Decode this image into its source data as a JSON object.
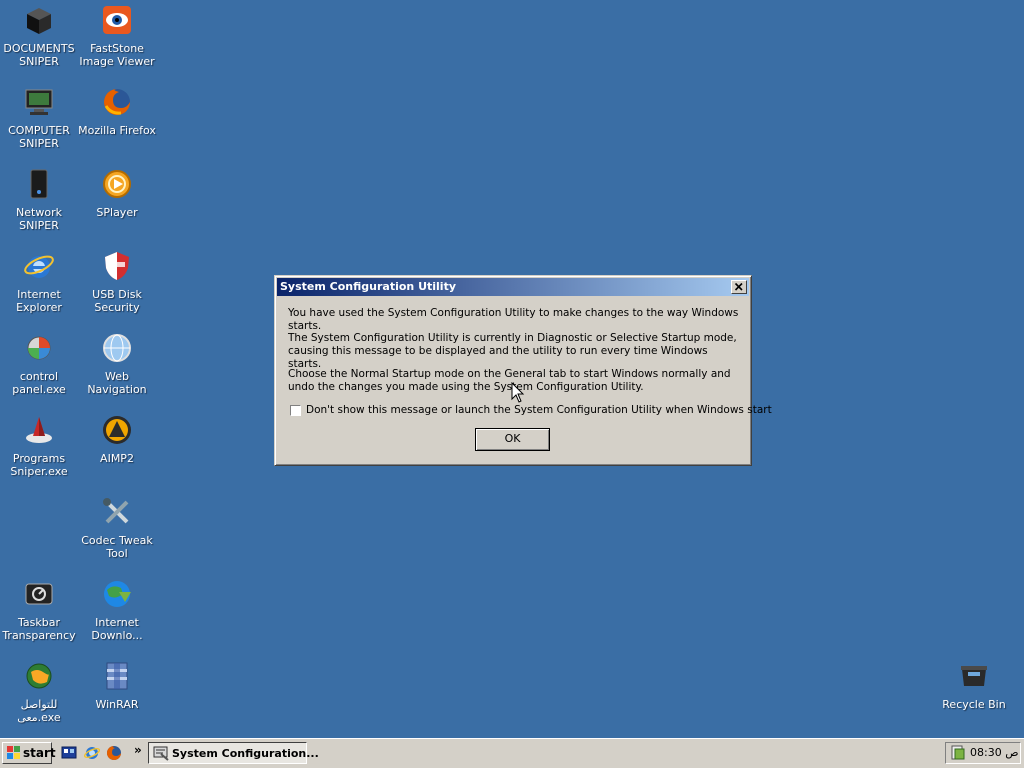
{
  "desktop": {
    "background_color": "#3a6ea5",
    "icons": [
      {
        "label": "DOCUMENTS\nSNIPER",
        "icon": "dark-box-icon"
      },
      {
        "label": "FastStone\nImage Viewer",
        "icon": "eye-icon"
      },
      {
        "label": "COMPUTER\nSNIPER",
        "icon": "computer-icon"
      },
      {
        "label": "Mozilla Firefox",
        "icon": "firefox-icon"
      },
      {
        "label": "Network\nSNIPER",
        "icon": "network-drive-icon"
      },
      {
        "label": "SPlayer",
        "icon": "splayer-icon"
      },
      {
        "label": "Internet\nExplorer",
        "icon": "internet-explorer-icon"
      },
      {
        "label": "USB Disk\nSecurity",
        "icon": "shield-icon"
      },
      {
        "label": "control\npanel.exe",
        "icon": "control-panel-icon"
      },
      {
        "label": "Web\nNavigation",
        "icon": "globe-icon"
      },
      {
        "label": "Programs\nSniper.exe",
        "icon": "programs-icon"
      },
      {
        "label": "AIMP2",
        "icon": "aimp-icon"
      },
      {
        "label": "Codec Tweak\nTool",
        "icon": "tools-icon"
      },
      {
        "label": "Taskbar\nTransparency",
        "icon": "taskbar-icon"
      },
      {
        "label": "Internet\nDownlo...",
        "icon": "download-globe-icon"
      },
      {
        "label": "للتواصل\nمعى.exe",
        "icon": "globe-people-icon"
      },
      {
        "label": "WinRAR",
        "icon": "winrar-icon"
      },
      {
        "label": "Recycle Bin",
        "icon": "recycle-bin-icon"
      }
    ]
  },
  "dialog": {
    "title": "System Configuration Utility",
    "message_1": "You have used the System Configuration Utility to make changes to the way Windows starts.",
    "message_2": "The System Configuration Utility is currently in Diagnostic or Selective Startup mode, causing this message to be displayed and the utility to run every time Windows starts.",
    "message_3": "Choose the Normal Startup mode on the General tab to start Windows normally and undo the changes you made using the System Configuration Utility.",
    "checkbox_label": "Don't show this message or launch the System Configuration Utility when Windows start",
    "checkbox_checked": false,
    "ok_label": "OK",
    "titlebar_color": "#0a246a"
  },
  "taskbar": {
    "start_label": "start",
    "quick_launch": [
      "desktop-icon",
      "internet-explorer-icon",
      "firefox-icon"
    ],
    "overflow_label": "»",
    "task_label": "System Configuration...",
    "clock": "08:30 ص"
  }
}
